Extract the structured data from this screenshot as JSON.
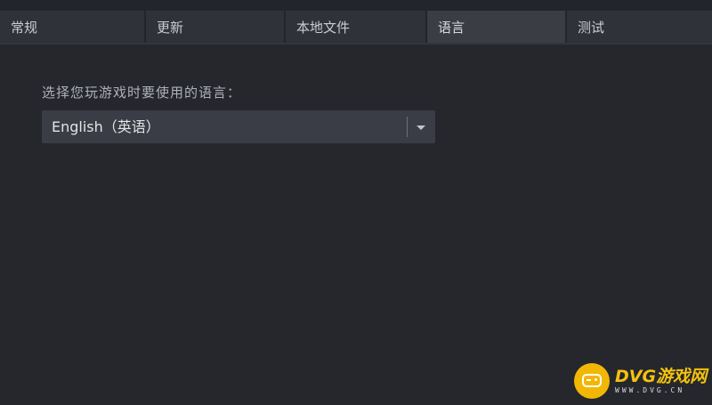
{
  "tabs": [
    {
      "label": "常规"
    },
    {
      "label": "更新"
    },
    {
      "label": "本地文件"
    },
    {
      "label": "语言",
      "active": true
    },
    {
      "label": "测试"
    }
  ],
  "language": {
    "prompt": "选择您玩游戏时要使用的语言：",
    "selected": "English（英语）"
  },
  "watermark": {
    "brand": "DVG游戏网",
    "url": "WWW.DVG.CN"
  },
  "colors": {
    "background": "#25272d",
    "tab": "#2f3239",
    "tab_active": "#3a3d44",
    "select": "#3a3d45",
    "watermark_accent": "#f2b705"
  }
}
